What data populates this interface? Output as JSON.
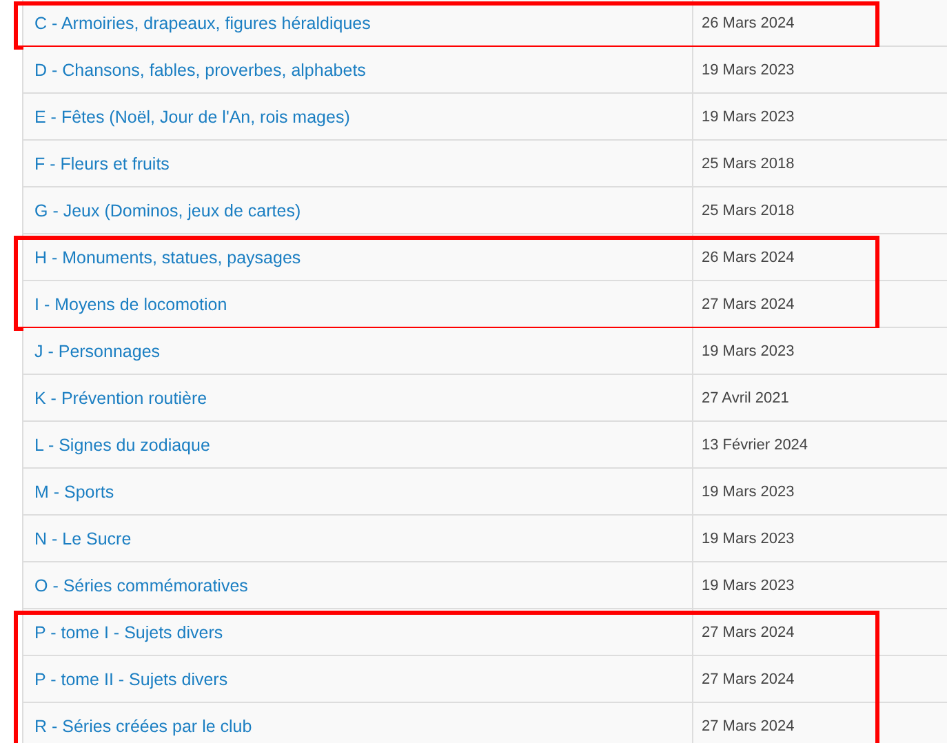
{
  "groups": [
    {
      "highlighted": true,
      "rows": [
        {
          "title": "C - Armoiries, drapeaux, figures héraldiques",
          "date": "26 Mars 2024"
        }
      ]
    },
    {
      "highlighted": false,
      "rows": [
        {
          "title": "D - Chansons, fables, proverbes, alphabets",
          "date": "19 Mars 2023"
        },
        {
          "title": "E - Fêtes (Noël, Jour de l'An, rois mages)",
          "date": "19 Mars 2023"
        },
        {
          "title": "F - Fleurs et fruits",
          "date": "25 Mars 2018"
        },
        {
          "title": "G - Jeux (Dominos, jeux de cartes)",
          "date": "25 Mars 2018"
        }
      ]
    },
    {
      "highlighted": true,
      "rows": [
        {
          "title": "H - Monuments, statues, paysages",
          "date": "26 Mars 2024"
        },
        {
          "title": "I - Moyens de locomotion",
          "date": "27 Mars 2024"
        }
      ]
    },
    {
      "highlighted": false,
      "rows": [
        {
          "title": "J - Personnages",
          "date": "19 Mars 2023"
        },
        {
          "title": "K - Prévention routière",
          "date": "27 Avril 2021"
        },
        {
          "title": "L - Signes du zodiaque",
          "date": "13 Février 2024"
        },
        {
          "title": "M - Sports",
          "date": "19 Mars 2023"
        },
        {
          "title": "N - Le Sucre",
          "date": "19 Mars 2023"
        },
        {
          "title": "O - Séries commémoratives",
          "date": "19 Mars 2023"
        }
      ]
    },
    {
      "highlighted": true,
      "rows": [
        {
          "title": "P - tome I - Sujets divers",
          "date": "27 Mars 2024"
        },
        {
          "title": "P - tome II - Sujets divers",
          "date": "27 Mars 2024"
        },
        {
          "title": "R - Séries créées par le club",
          "date": "27 Mars 2024"
        }
      ]
    }
  ]
}
